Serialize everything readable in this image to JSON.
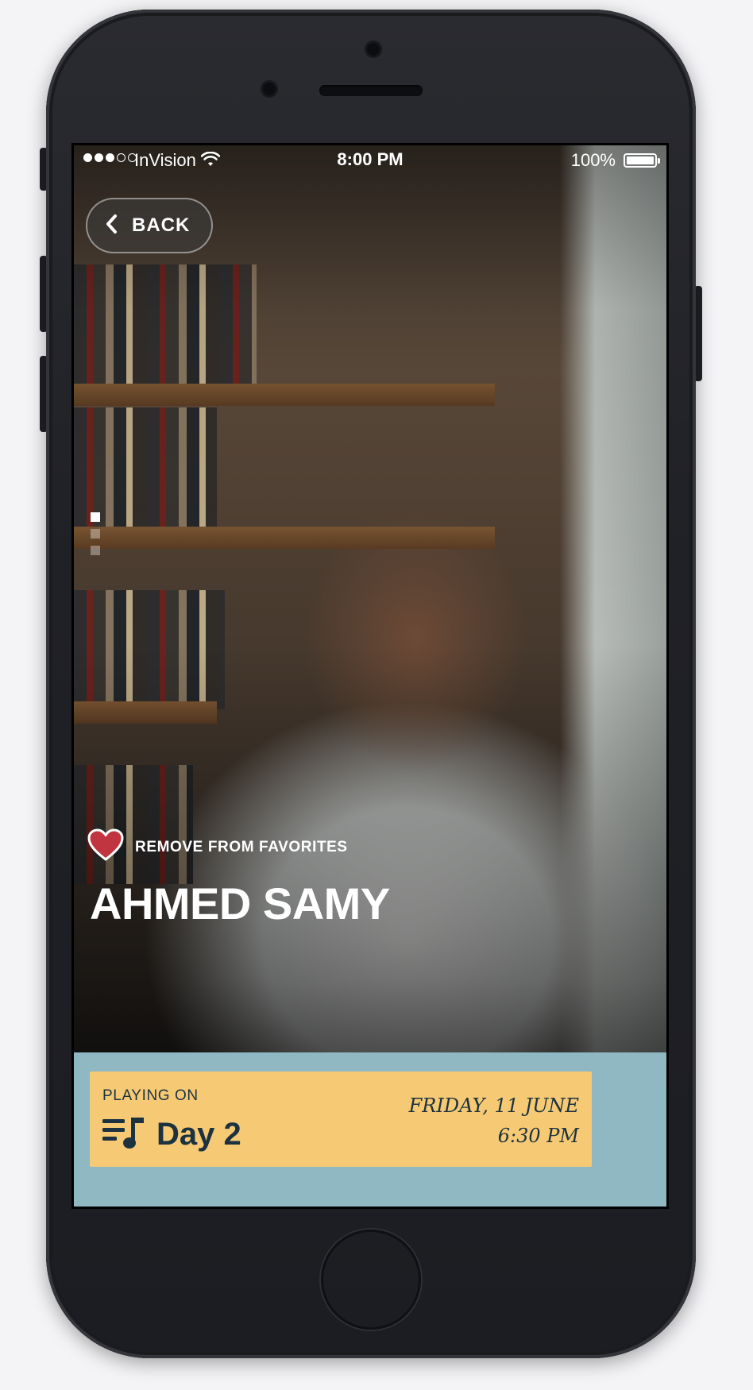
{
  "status_bar": {
    "carrier": "InVision",
    "time": "8:00 PM",
    "battery": "100%"
  },
  "back_button": {
    "label": "BACK"
  },
  "favorite": {
    "label": "REMOVE FROM FAVORITES"
  },
  "artist": {
    "name": "AHMED SAMY"
  },
  "schedule": {
    "playing_on_label": "PLAYING ON",
    "day": "Day 2",
    "date": "FRIDAY, 11 JUNE",
    "time": "6:30 PM"
  },
  "pager": {
    "total": 3,
    "active": 1
  },
  "colors": {
    "panel": "#8fb8c2",
    "card": "#f6ca74",
    "ink": "#1d3240",
    "heart": "#c0353f"
  }
}
